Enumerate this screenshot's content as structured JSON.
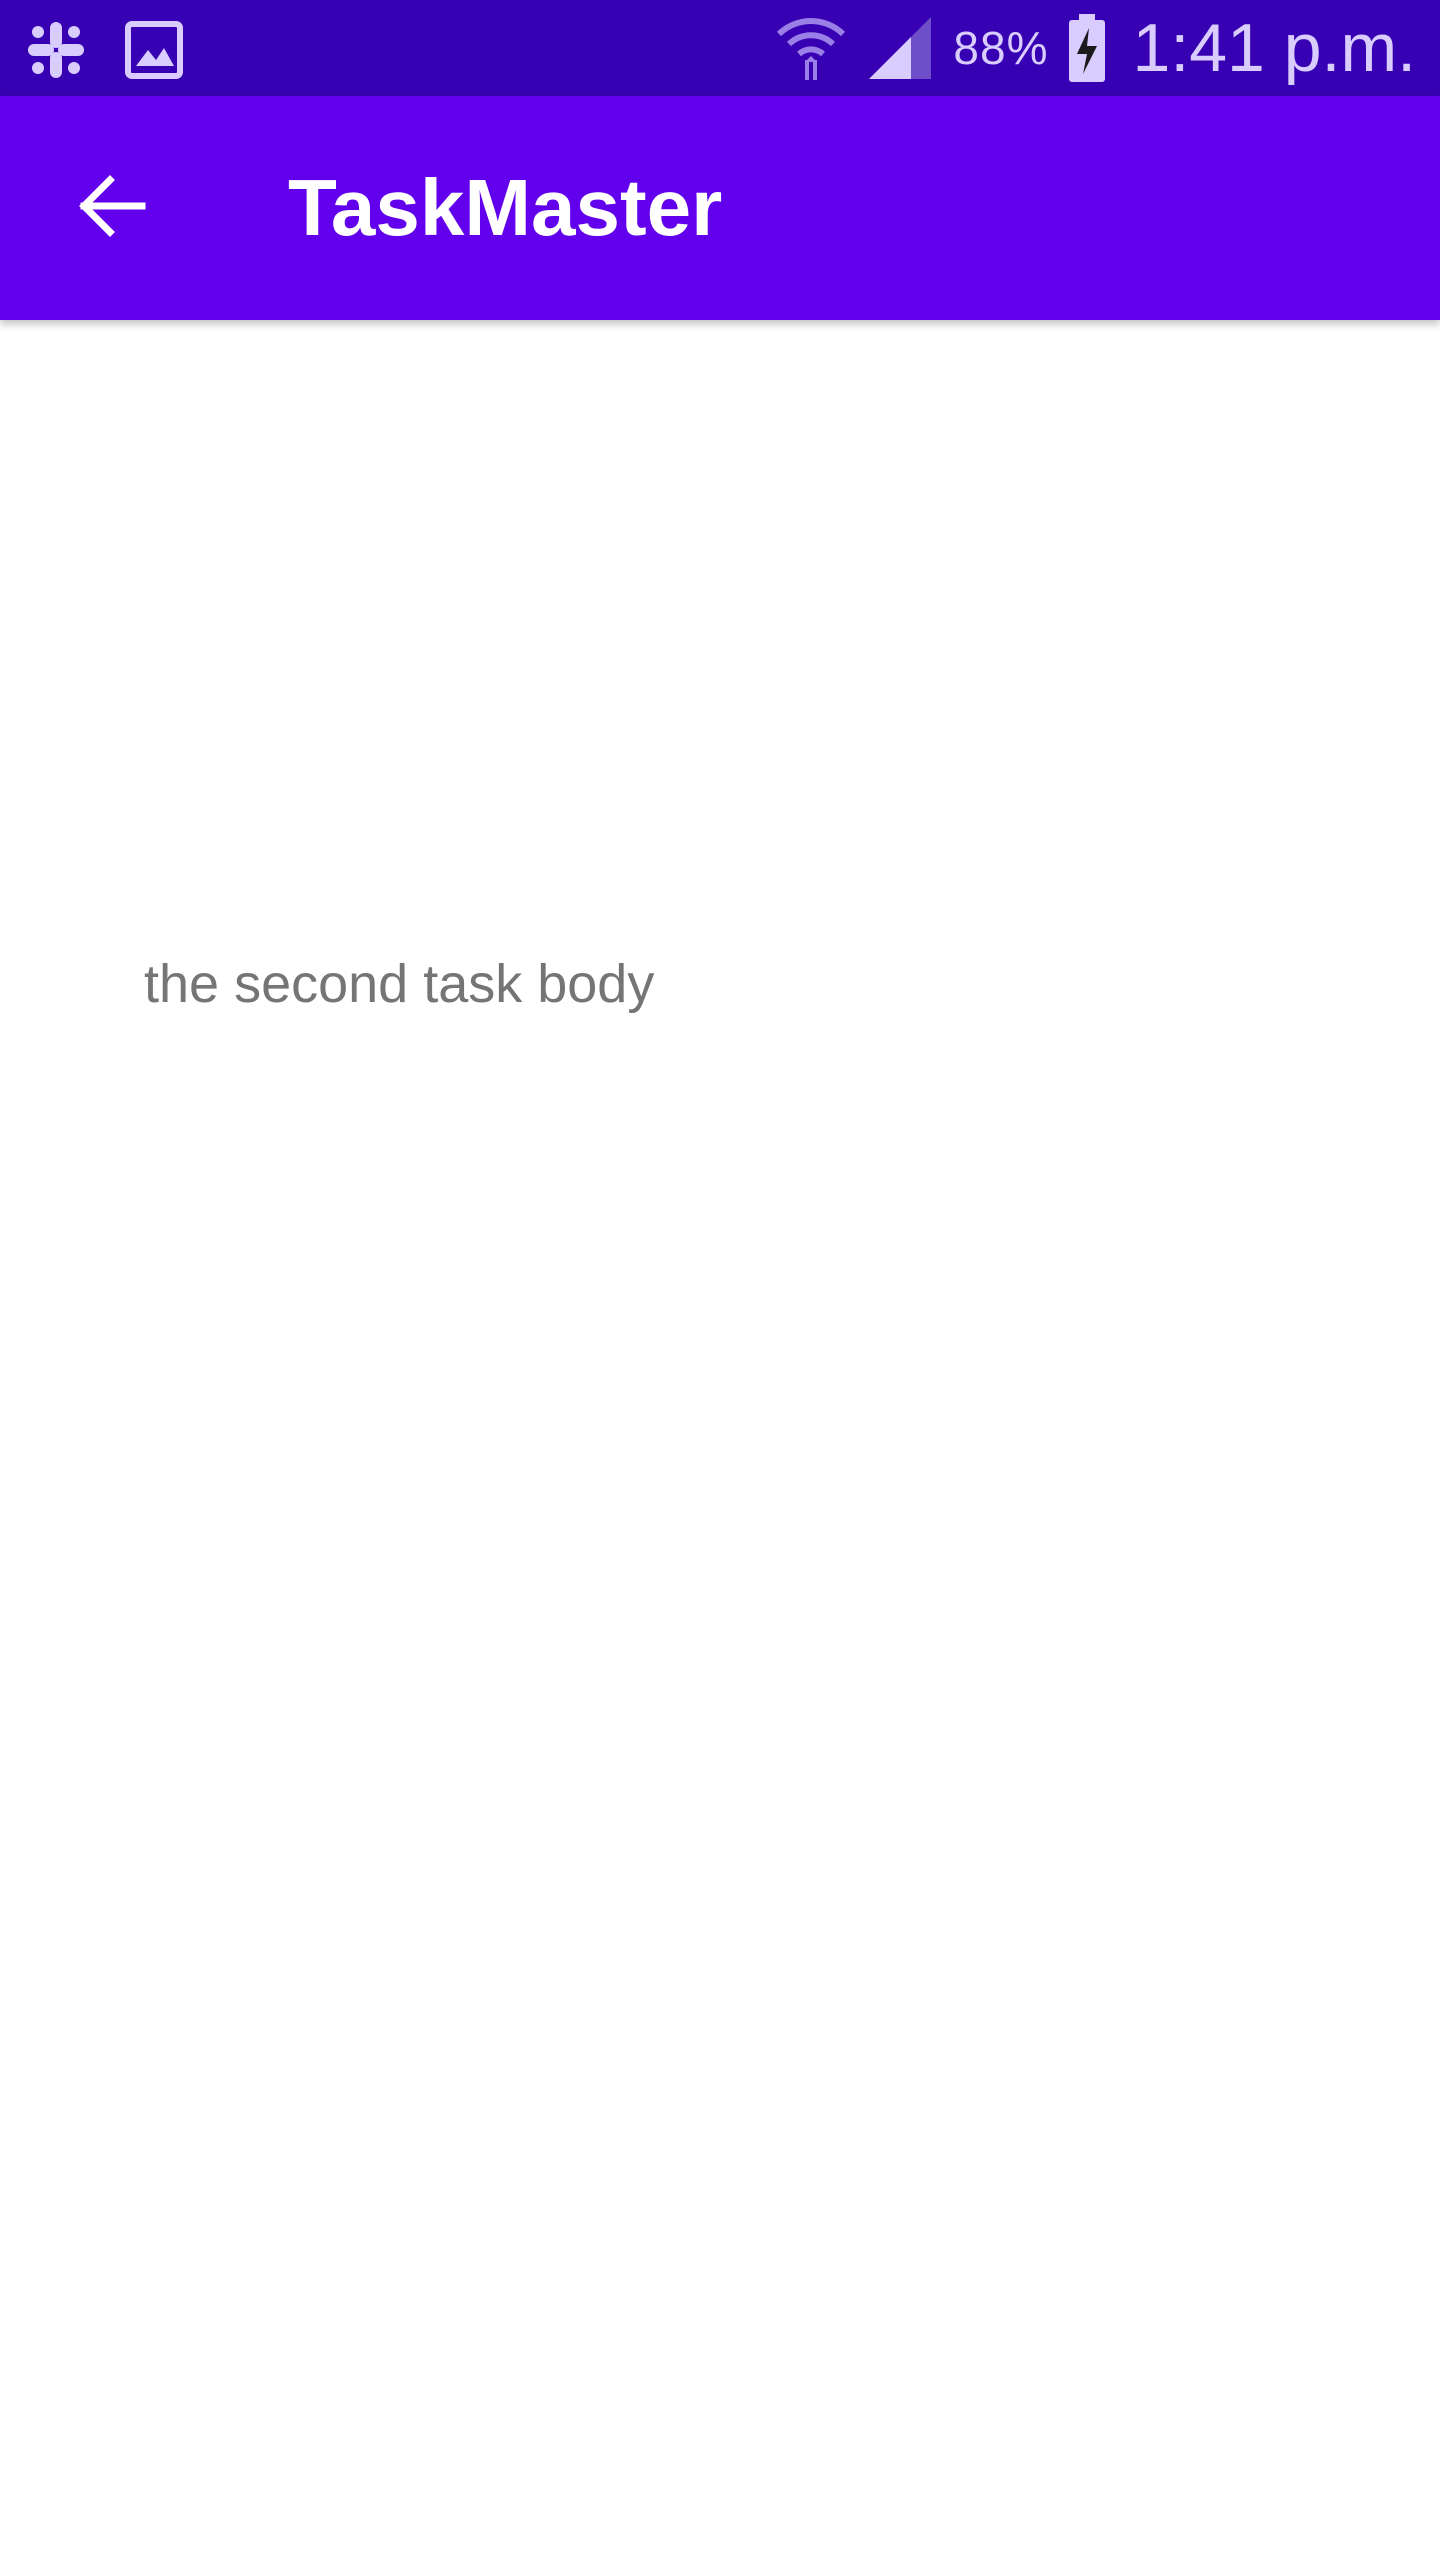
{
  "status_bar": {
    "icons_left": [
      "slack-icon",
      "image-icon"
    ],
    "icons_right": [
      "wifi-icon",
      "signal-icon",
      "battery-charging-icon"
    ],
    "battery_percent": "88%",
    "time": "1:41 p.m.",
    "background_color": "#3700b3"
  },
  "app_bar": {
    "title": "TaskMaster",
    "back_icon": "arrow-back-icon",
    "background_color": "#6200ee"
  },
  "task": {
    "body": "the second task body"
  }
}
